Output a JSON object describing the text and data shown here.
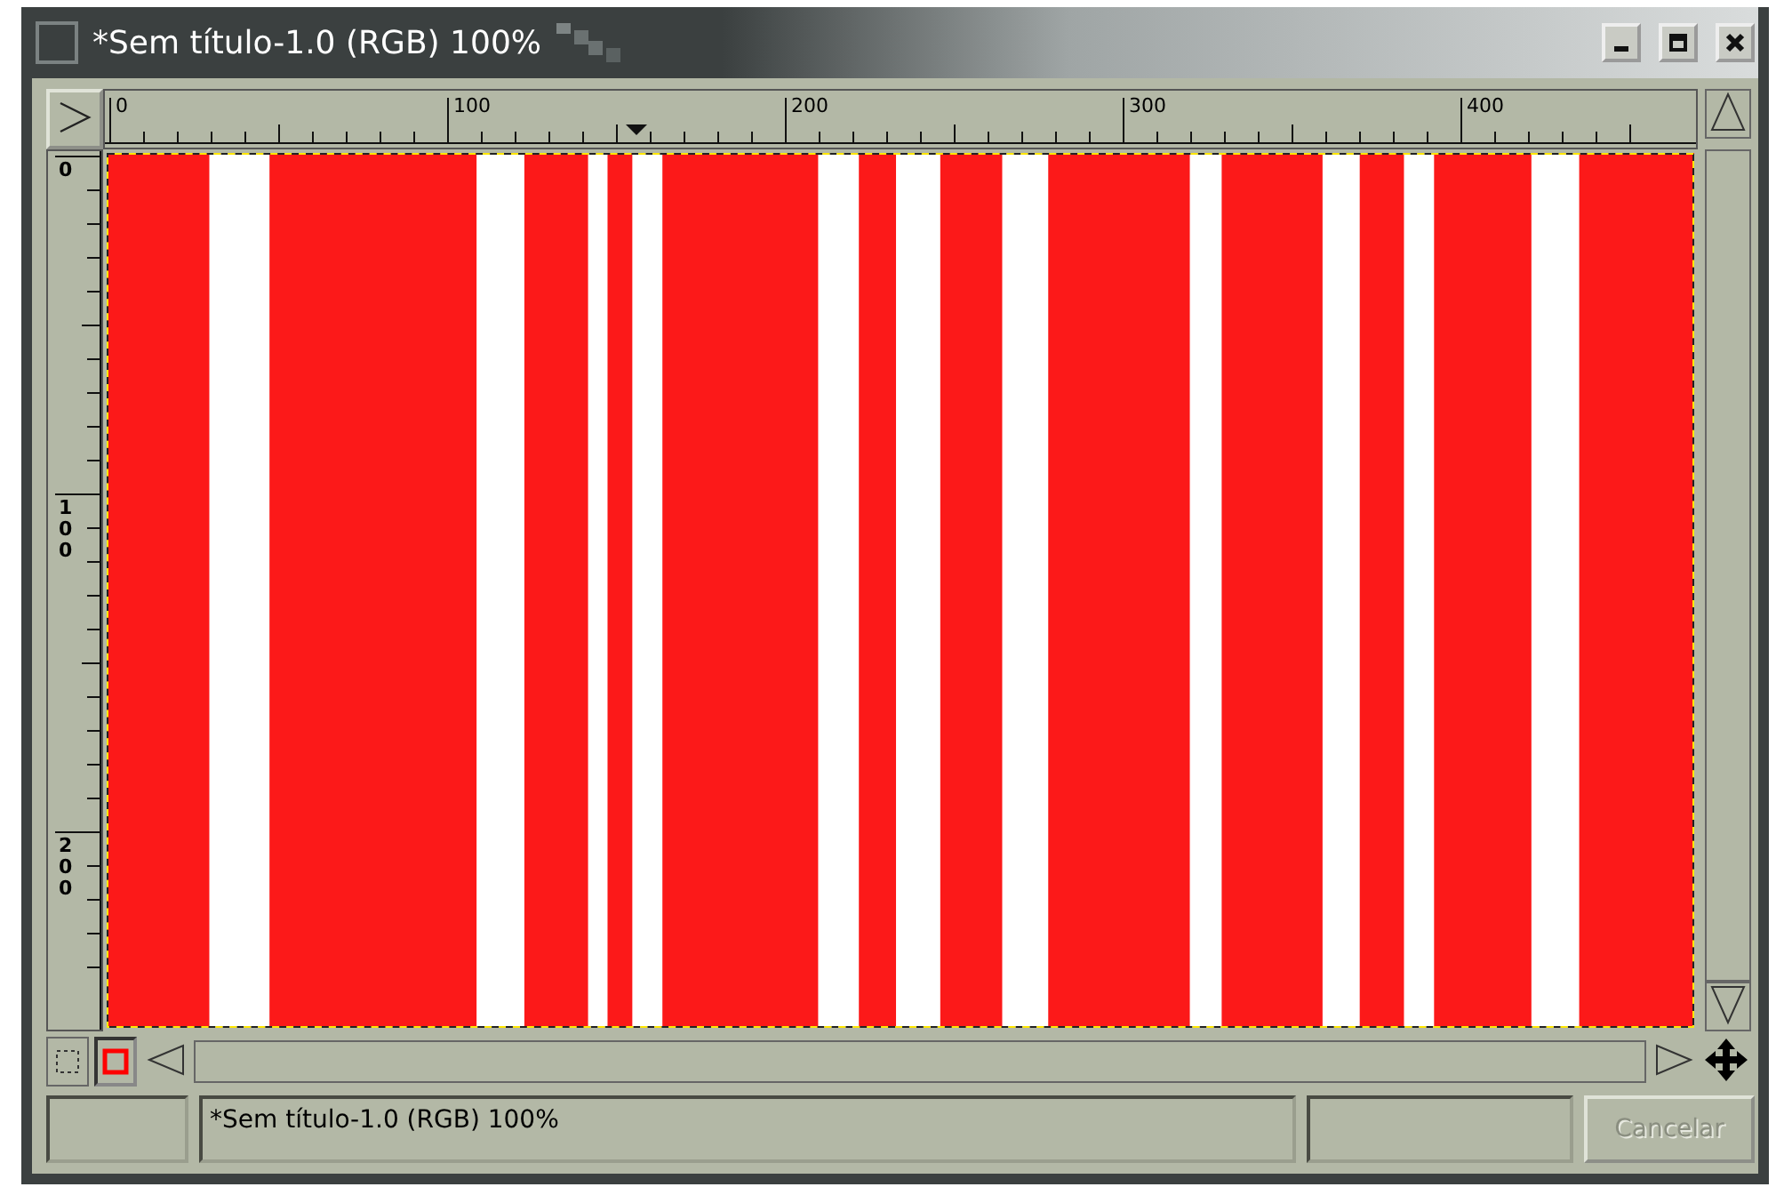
{
  "window": {
    "title": "*Sem título-1.0 (RGB) 100%"
  },
  "rulers": {
    "horizontal": [
      "0",
      "100",
      "200",
      "300",
      "400"
    ],
    "vertical": [
      "0",
      "100",
      "200"
    ]
  },
  "status_bar": {
    "message": "*Sem título-1.0 (RGB) 100%",
    "cancel_button": {
      "label": "Cancelar",
      "disabled": true
    }
  }
}
